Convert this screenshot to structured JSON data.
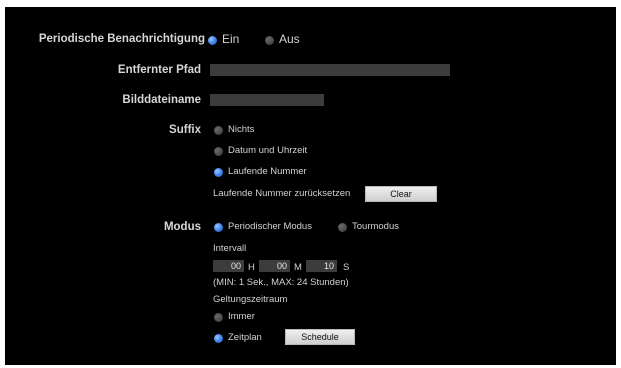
{
  "periodic": {
    "label": "Periodische Benachrichtigung",
    "options": [
      "Ein",
      "Aus"
    ],
    "selected": "Ein"
  },
  "remote_path": {
    "label": "Entfernter Pfad",
    "value": ""
  },
  "image_filename": {
    "label": "Bilddateiname",
    "value": ""
  },
  "suffix": {
    "label": "Suffix",
    "options": [
      "Nichts",
      "Datum und Uhrzeit",
      "Laufende Nummer"
    ],
    "selected": "Laufende Nummer",
    "reset_label": "Laufende Nummer zurücksetzen",
    "clear_label": "Clear"
  },
  "mode": {
    "label": "Modus",
    "options": [
      "Periodischer Modus",
      "Tourmodus"
    ],
    "selected": "Periodischer Modus",
    "interval_label": "Intervall",
    "hours": "00",
    "hours_unit": "H",
    "minutes": "00",
    "minutes_unit": "M",
    "seconds": "10",
    "seconds_unit": "S",
    "range_note": "(MIN: 1 Sek., MAX: 24 Stunden)",
    "validity_label": "Geltungszeitraum",
    "validity_options": [
      "Immer",
      "Zeitplan"
    ],
    "validity_selected": "Zeitplan",
    "schedule_label": "Schedule"
  },
  "colors": {
    "background": "#000000",
    "radio_selected": "#3c7ee8",
    "radio_unselected": "#4a4a4a",
    "field": "#3c3c3c"
  }
}
